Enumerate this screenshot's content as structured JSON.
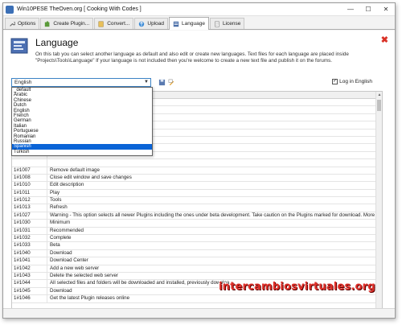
{
  "window": {
    "title": "Win10PESE   TheOven.org [ Cooking With Codes ]",
    "controls": [
      "minimize",
      "maximize",
      "close"
    ]
  },
  "tabs": [
    {
      "label": "Options",
      "icon": "wrench-icon"
    },
    {
      "label": "Create Plugin...",
      "icon": "puzzle-icon"
    },
    {
      "label": "Convert...",
      "icon": "convert-icon"
    },
    {
      "label": "Upload",
      "icon": "upload-icon"
    },
    {
      "label": "Language",
      "icon": "language-icon",
      "active": true
    },
    {
      "label": "License",
      "icon": "license-icon"
    }
  ],
  "page": {
    "title": "Language",
    "description": "On this tab you can select another language as default and also edit or create new languages. Text files for each language are placed inside \"Projects\\Tools\\Language\" If your language is not included then you're welcome to create a new text file and publish it on the forums."
  },
  "toolbar": {
    "selected_language": "English",
    "log_label": "Log in English",
    "log_checked": true
  },
  "dropdown": {
    "options": [
      "_default",
      "Arabic",
      "Chinese",
      "Dutch",
      "English",
      "French",
      "German",
      "Italian",
      "Portuguese",
      "Romanian",
      "Russian",
      "Spanish",
      "Turkish"
    ],
    "highlighted": "Spanish"
  },
  "grid_rows": [
    {
      "id": "",
      "text": ""
    },
    {
      "id": "",
      "text": ""
    },
    {
      "id": "",
      "text": ""
    },
    {
      "id": "",
      "text": ""
    },
    {
      "id": "",
      "text": ""
    },
    {
      "id": "",
      "text": ""
    },
    {
      "id": "",
      "text": ""
    },
    {
      "id": "",
      "text": ""
    },
    {
      "id": "",
      "text": ""
    },
    {
      "id": "1#1007",
      "text": "Remove default image"
    },
    {
      "id": "1#1008",
      "text": "Close edit window and save changes"
    },
    {
      "id": "1#1010",
      "text": "Edit description"
    },
    {
      "id": "1#1011",
      "text": "Play"
    },
    {
      "id": "1#1012",
      "text": "Tools"
    },
    {
      "id": "1#1013",
      "text": "Refresh"
    },
    {
      "id": "1#1027",
      "text": "Warning - This option selects all newer Plugins including the ones under beta development. Take caution on the Plugins marked for download. More informati"
    },
    {
      "id": "1#1030",
      "text": "Minimum"
    },
    {
      "id": "1#1031",
      "text": "Recommended"
    },
    {
      "id": "1#1032",
      "text": "Complete"
    },
    {
      "id": "1#1033",
      "text": "Beta"
    },
    {
      "id": "1#1040",
      "text": "Download"
    },
    {
      "id": "1#1041",
      "text": "Download Center"
    },
    {
      "id": "1#1042",
      "text": "Add a new web server"
    },
    {
      "id": "1#1043",
      "text": "Delete the selected web server"
    },
    {
      "id": "1#1044",
      "text": "All selected files and folders will be downloaded and installed, previously downloa"
    },
    {
      "id": "1#1045",
      "text": "Download"
    },
    {
      "id": "1#1046",
      "text": "Get the latest Plugin releases online"
    }
  ],
  "watermark": "intercambiosvirtuales.org",
  "colors": {
    "selection": "#0a64d7",
    "close_accent": "#d93025",
    "watermark": "#e0302a"
  }
}
